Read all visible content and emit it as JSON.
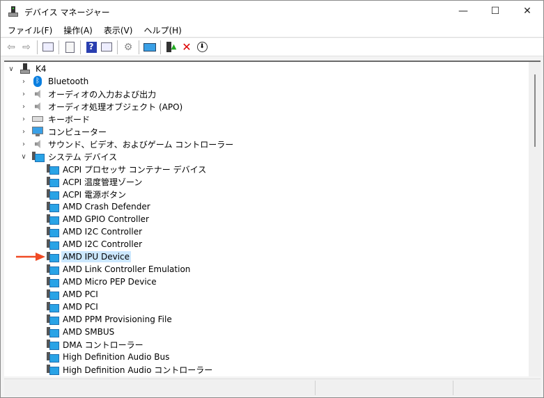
{
  "window": {
    "title": "デバイス マネージャー",
    "minimize": "—",
    "maximize": "☐",
    "close": "✕"
  },
  "menu": [
    "ファイル(F)",
    "操作(A)",
    "表示(V)",
    "ヘルプ(H)"
  ],
  "toolbar": [
    "back-icon",
    "forward-icon",
    "show-hide-console-tree-icon",
    "properties-icon",
    "help-icon",
    "action-pane-icon",
    "update-driver-icon",
    "scan-hardware-icon",
    "enable-device-icon",
    "uninstall-icon",
    "disable-icon"
  ],
  "tree": {
    "root": "K4",
    "categories": [
      "Bluetooth",
      "オーディオの入力および出力",
      "オーディオ処理オブジェクト (APO)",
      "キーボード",
      "コンピューター",
      "サウンド、ビデオ、およびゲーム コントローラー",
      "システム デバイス"
    ],
    "system_devices": [
      "ACPI プロセッサ コンテナー デバイス",
      "ACPI 温度管理ゾーン",
      "ACPI 電源ボタン",
      "AMD Crash Defender",
      "AMD GPIO Controller",
      "AMD I2C Controller",
      "AMD I2C Controller",
      "AMD IPU Device",
      "AMD Link Controller Emulation",
      "AMD Micro PEP Device",
      "AMD PCI",
      "AMD PCI",
      "AMD PPM Provisioning File",
      "AMD SMBUS",
      "DMA コントローラー",
      "High Definition Audio Bus",
      "High Definition Audio コントローラー"
    ],
    "selected": "AMD IPU Device"
  },
  "colors": {
    "selection": "#cce8ff",
    "annotation_arrow": "#f04a24"
  }
}
